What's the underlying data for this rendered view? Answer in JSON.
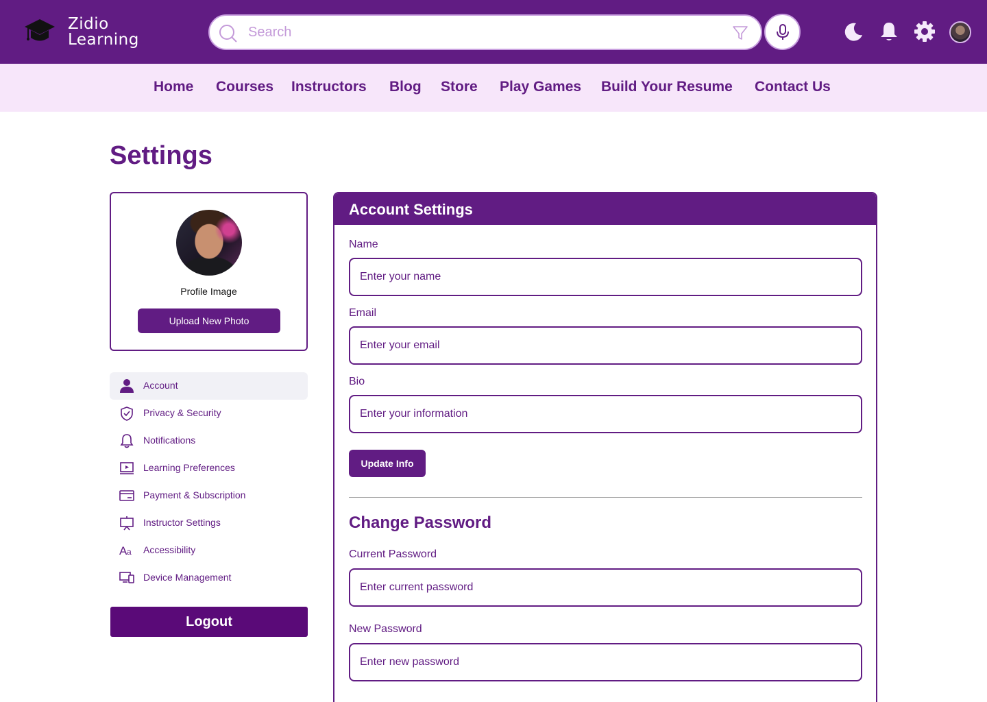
{
  "brand": {
    "line1": "Zidio",
    "line2": "Learning"
  },
  "search": {
    "placeholder": "Search"
  },
  "nav": [
    {
      "label": "Home"
    },
    {
      "label": "Courses"
    },
    {
      "label": "Instructors"
    },
    {
      "label": "Blog"
    },
    {
      "label": "Store"
    },
    {
      "label": "Play Games"
    },
    {
      "label": "Build Your Resume"
    },
    {
      "label": "Contact Us"
    }
  ],
  "page": {
    "title": "Settings"
  },
  "profile": {
    "label": "Profile Image",
    "upload_label": "Upload New Photo"
  },
  "sidebar": {
    "items": [
      {
        "label": "Account",
        "icon": "user-icon",
        "active": true
      },
      {
        "label": "Privacy & Security",
        "icon": "shield-check-icon"
      },
      {
        "label": "Notifications",
        "icon": "bell-icon"
      },
      {
        "label": "Learning Preferences",
        "icon": "video-icon"
      },
      {
        "label": "Payment & Subscription",
        "icon": "credit-card-icon"
      },
      {
        "label": "Instructor Settings",
        "icon": "presentation-icon"
      },
      {
        "label": "Accessibility",
        "icon": "text-size-icon"
      },
      {
        "label": "Device Management",
        "icon": "devices-icon"
      }
    ],
    "logout_label": "Logout"
  },
  "account": {
    "title": "Account Settings",
    "fields": [
      {
        "label": "Name",
        "placeholder": "Enter your name"
      },
      {
        "label": "Email",
        "placeholder": "Enter your email"
      },
      {
        "label": "Bio",
        "placeholder": "Enter your information"
      }
    ],
    "update_label": "Update Info"
  },
  "password": {
    "title": "Change Password",
    "fields": [
      {
        "label": "Current Password",
        "placeholder": "Enter current password"
      },
      {
        "label": "New Password",
        "placeholder": "Enter new password"
      }
    ]
  },
  "colors": {
    "primary": "#611c83",
    "nav_bg": "#f7e6fa",
    "logout": "#5a0a78"
  }
}
